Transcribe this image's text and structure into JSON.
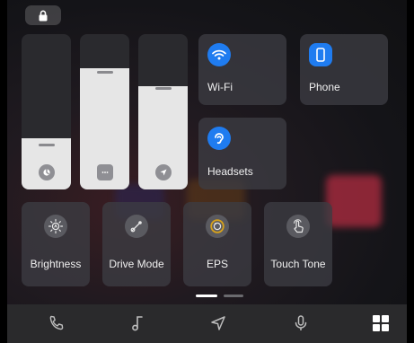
{
  "tiles": {
    "wifi": {
      "label": "Wi-Fi",
      "icon": "wifi-icon"
    },
    "phone": {
      "label": "Phone",
      "icon": "phone-icon"
    },
    "headsets": {
      "label": "Headsets",
      "icon": "headset-icon"
    }
  },
  "sliders": [
    {
      "icon": "volume-icon",
      "level": 0.33
    },
    {
      "icon": "message-icon",
      "level": 0.78
    },
    {
      "icon": "navigation-icon",
      "level": 0.66
    }
  ],
  "buttons": [
    {
      "label": "Brightness",
      "icon": "brightness-icon"
    },
    {
      "label": "Drive Mode",
      "icon": "drive-mode-icon"
    },
    {
      "label": "EPS",
      "icon": "eps-icon"
    },
    {
      "label": "Touch Tone",
      "icon": "touch-tone-icon"
    }
  ],
  "pager": {
    "pages": 2,
    "current": 1
  },
  "dock": [
    {
      "icon": "phone-call-icon"
    },
    {
      "icon": "music-icon"
    },
    {
      "icon": "navigation-icon"
    },
    {
      "icon": "microphone-icon"
    },
    {
      "icon": "apps-grid-icon",
      "active": true
    }
  ],
  "colors": {
    "accent": "#1f7cf0",
    "eps_ring": "#d7a21b"
  }
}
